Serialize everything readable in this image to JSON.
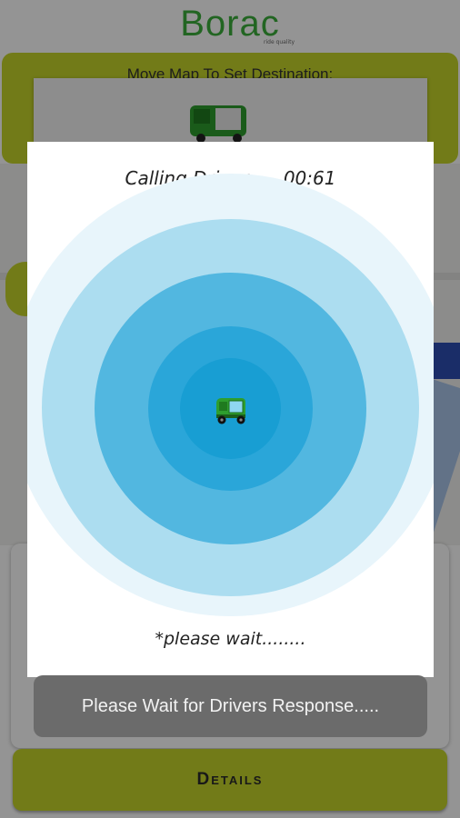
{
  "app": {
    "logo_text": "Borac",
    "logo_tagline": "ride quality",
    "brand_color": "#c4d42a",
    "logo_color": "#3cae3c"
  },
  "destination": {
    "label": "Move Map To Set Destination:"
  },
  "dialog": {
    "title": "Calling Driver .....00:61",
    "wait_text": "*please wait........",
    "icon": "auto-rickshaw-icon",
    "ring_colors": [
      "#e8f5fb",
      "#acddf0",
      "#52b7e0",
      "#2aa6d9",
      "#189ed3"
    ]
  },
  "toast": {
    "message": "Please Wait for Drivers Response....."
  },
  "footer": {
    "details_label": "Details"
  }
}
